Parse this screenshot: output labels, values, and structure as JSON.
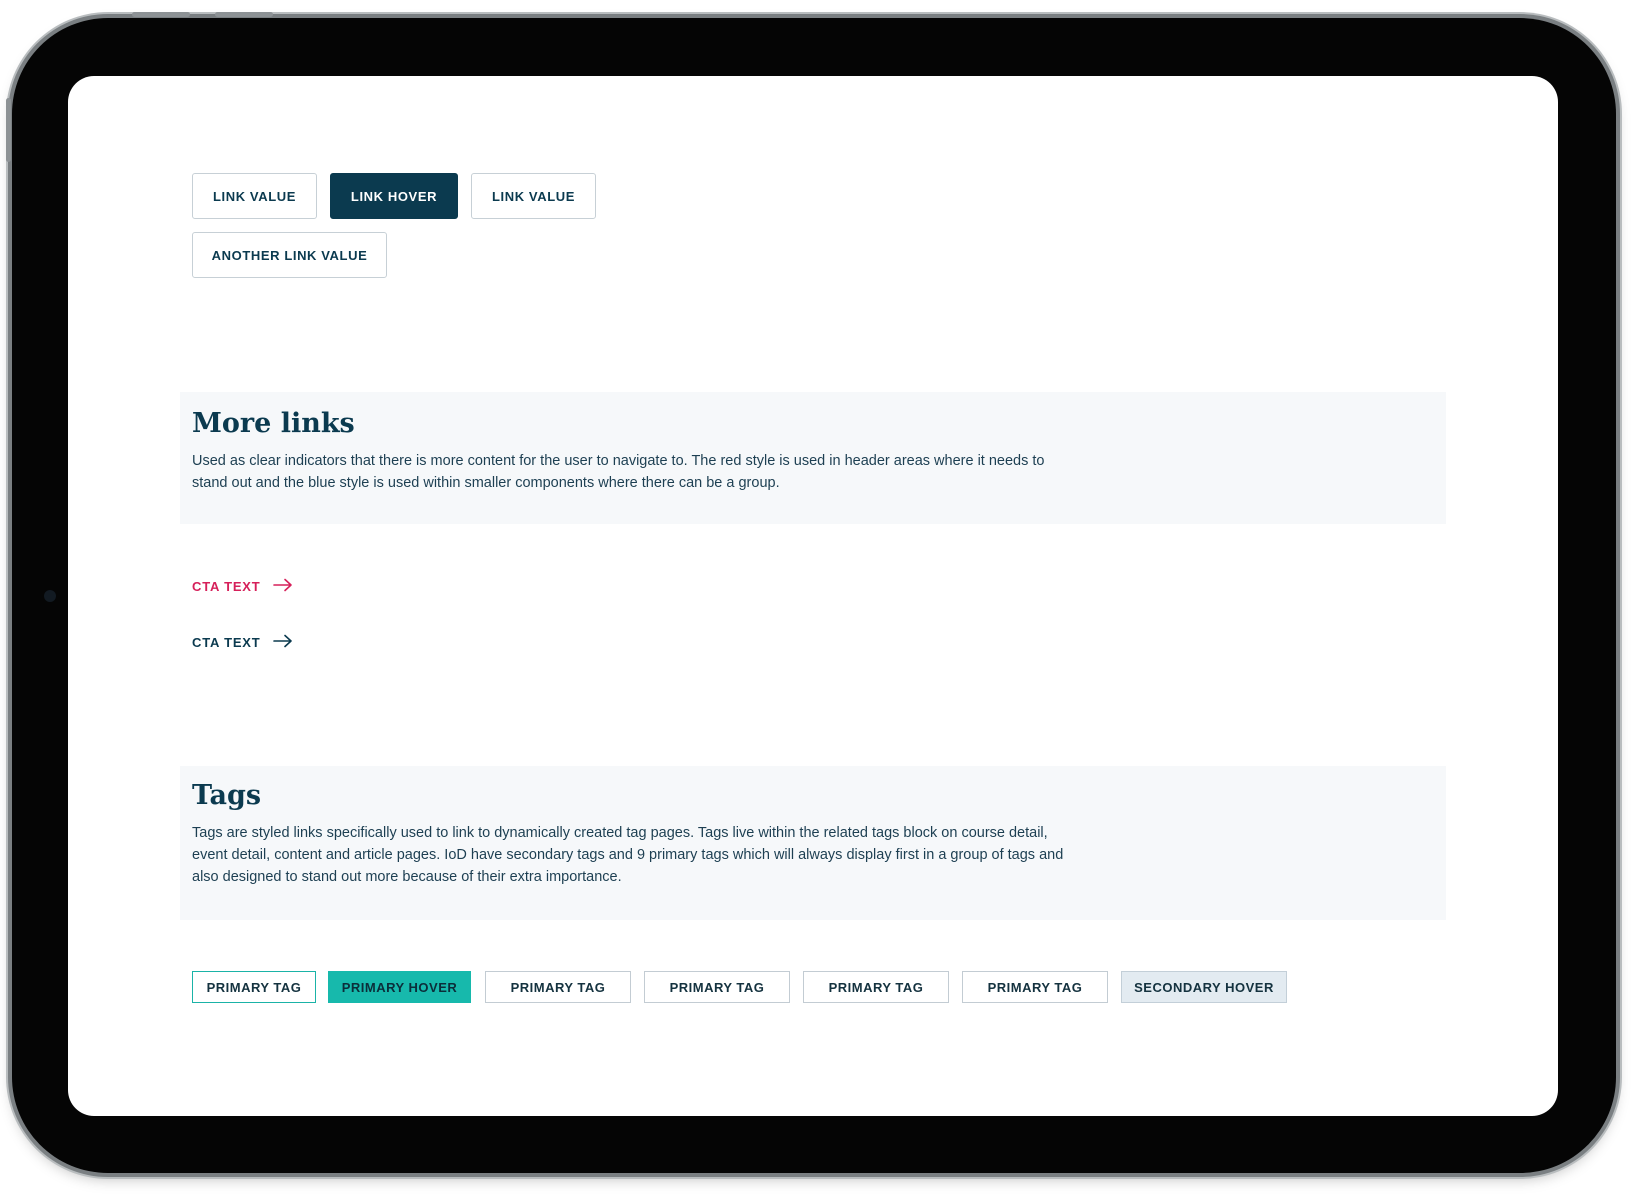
{
  "link_buttons": [
    {
      "label": "LINK VALUE",
      "state": "default"
    },
    {
      "label": "LINK HOVER",
      "state": "hover"
    },
    {
      "label": "LINK VALUE",
      "state": "default"
    },
    {
      "label": "ANOTHER LINK VALUE",
      "state": "default"
    }
  ],
  "more_links": {
    "title": "More links",
    "description": "Used as clear indicators that there is more content for the user to navigate to. The red style is used in header areas  where it needs to stand out and the blue style is used within smaller components where there can be a group."
  },
  "cta_links": [
    {
      "label": "CTA TEXT",
      "color": "#d6205a",
      "icon": "arrow-right-icon"
    },
    {
      "label": "CTA TEXT",
      "color": "#0b3a4f",
      "icon": "arrow-right-icon"
    }
  ],
  "tags_section": {
    "title": "Tags",
    "description": "Tags are styled links specifically used to link to dynamically created tag pages. Tags live within the related tags block on course detail, event detail, content and article pages. IoD have secondary tags and 9 primary tags which will always display first in a group of tags and also designed to stand out more because of their extra importance."
  },
  "tags": [
    {
      "label": "PRIMARY TAG",
      "style": "primary-outline"
    },
    {
      "label": "PRIMARY HOVER",
      "style": "primary-hover"
    },
    {
      "label": "PRIMARY TAG",
      "style": "secondary"
    },
    {
      "label": "PRIMARY TAG",
      "style": "secondary"
    },
    {
      "label": "PRIMARY TAG",
      "style": "secondary"
    },
    {
      "label": "PRIMARY TAG",
      "style": "secondary"
    },
    {
      "label": "SECONDARY HOVER",
      "style": "secondary-hover"
    }
  ],
  "colors": {
    "brand_navy": "#0b3a4f",
    "cta_red": "#d6205a",
    "tag_teal": "#17b9ac",
    "panel_bg": "#f6f8fa"
  }
}
